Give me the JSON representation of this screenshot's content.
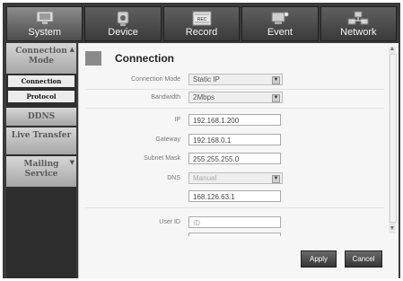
{
  "tabs": [
    {
      "label": "System",
      "icon": "monitor-icon",
      "active": true
    },
    {
      "label": "Device",
      "icon": "camera-icon",
      "active": false
    },
    {
      "label": "Record",
      "icon": "record-icon",
      "icon_text": "REC",
      "active": false
    },
    {
      "label": "Event",
      "icon": "event-icon",
      "active": false
    },
    {
      "label": "Network",
      "icon": "network-icon",
      "active": false
    }
  ],
  "menu": {
    "connection_mode": "Connection Mode",
    "sub_connection": "Connection",
    "sub_protocol": "Protocol",
    "ddns": "DDNS",
    "live_transfer": "Live Transfer",
    "mailing_service": "Mailing Service"
  },
  "panel": {
    "title": "Connection",
    "connection_mode_label": "Connection Mode",
    "connection_mode_value": "Static IP",
    "bandwidth_label": "Bandwidth",
    "bandwidth_value": "2Mbps",
    "ip_label": "IP",
    "ip_value": "192.168.1.200",
    "gateway_label": "Gateway",
    "gateway_value": "192.168.0.1",
    "subnet_label": "Subnet Mask",
    "subnet_value": "255.255.255.0",
    "dns_label": "DNS",
    "dns_value": "Manual",
    "dns_server": "168.126.63.1",
    "user_id_label": "User ID",
    "user_id_placeholder": "ID"
  },
  "buttons": {
    "apply": "Apply",
    "cancel": "Cancel"
  },
  "colors": {
    "background": "#3a3a3a",
    "panel": "#f6f6f6",
    "button": "#4a4a4a"
  }
}
